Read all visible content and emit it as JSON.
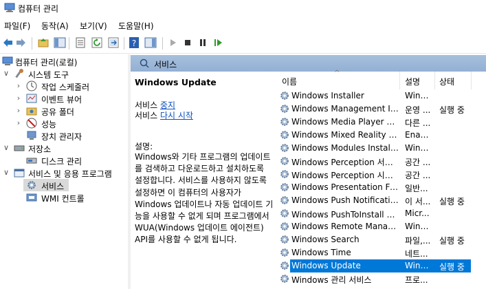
{
  "window": {
    "title": "컴퓨터 관리"
  },
  "menu": {
    "items": [
      "파일(F)",
      "동작(A)",
      "보기(V)",
      "도움말(H)"
    ]
  },
  "tree": {
    "root": "컴퓨터 관리(로컬)",
    "system_tools": "시스템 도구",
    "task_scheduler": "작업 스케줄러",
    "event_viewer": "이벤트 뷰어",
    "shared_folders": "공유 폴더",
    "performance": "성능",
    "device_manager": "장치 관리자",
    "storage": "저장소",
    "disk_management": "디스크 관리",
    "services_apps": "서비스 및 응용 프로그램",
    "services": "서비스",
    "wmi": "WMI 컨트롤"
  },
  "header": {
    "label": "서비스"
  },
  "detail": {
    "service_name": "Windows Update",
    "action_prefix": "서비스",
    "action_stop": "중지",
    "action_restart": "다시 시작",
    "desc_title": "설명:",
    "description": "Windows와 기타 프로그램의 업데이트를 검색하고 다운로드하고 설치하도록 설정합니다. 서비스를 사용하지 않도록 설정하면 이 컴퓨터의 사용자가 Windows 업데이트나 자동 업데이트 기능을 사용할 수 없게 되며 프로그램에서 WUA(Windows 업데이트 에이전트) API를 사용할 수 없게 됩니다."
  },
  "list": {
    "columns": {
      "name": "이름",
      "description": "설명",
      "status": "상태"
    },
    "rows": [
      {
        "name": "Windows Installer",
        "description": "Wind...",
        "status": ""
      },
      {
        "name": "Windows Management Inst...",
        "description": "운영 ...",
        "status": "실행 중"
      },
      {
        "name": "Windows Media Player Net...",
        "description": "다른 ...",
        "status": ""
      },
      {
        "name": "Windows Mixed Reality Op...",
        "description": "Enab...",
        "status": ""
      },
      {
        "name": "Windows Modules Installer",
        "description": "Wind...",
        "status": ""
      },
      {
        "name": "Windows Perception 서비스",
        "description": "공간 ...",
        "status": ""
      },
      {
        "name": "Windows Perception 시뮬...",
        "description": "공간 ...",
        "status": ""
      },
      {
        "name": "Windows Presentation Fou...",
        "description": "일반...",
        "status": ""
      },
      {
        "name": "Windows Push Notification...",
        "description": "이 서...",
        "status": "실행 중"
      },
      {
        "name": "Windows PushToInstall 서...",
        "description": "Micr...",
        "status": ""
      },
      {
        "name": "Windows Remote Manage...",
        "description": "WinR...",
        "status": ""
      },
      {
        "name": "Windows Search",
        "description": "파일,...",
        "status": "실행 중"
      },
      {
        "name": "Windows Time",
        "description": "네트...",
        "status": ""
      },
      {
        "name": "Windows Update",
        "description": "Wind...",
        "status": "실행 중"
      },
      {
        "name": "Windows 관리 서비스",
        "description": "프로...",
        "status": ""
      }
    ]
  }
}
